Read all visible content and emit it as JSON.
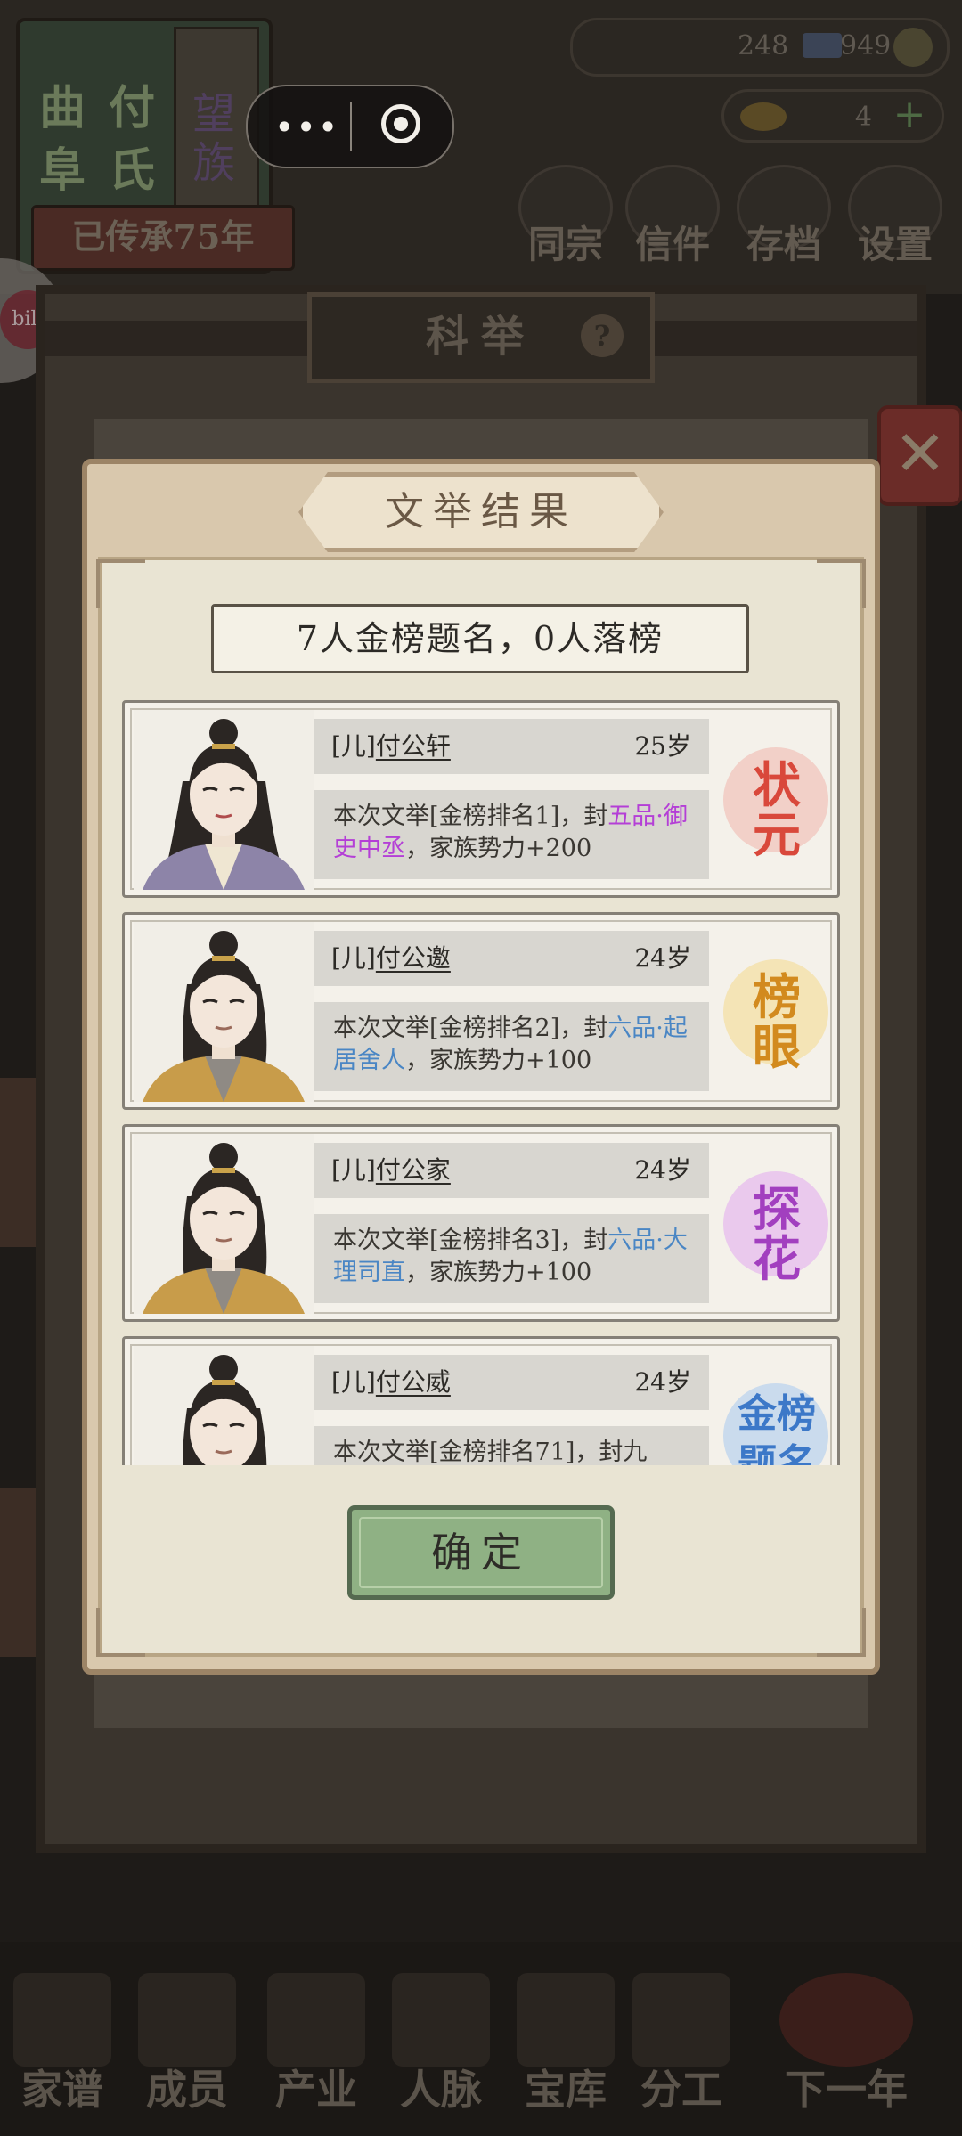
{
  "wechat_capsule": {
    "more_label": "•••"
  },
  "clan": {
    "chars_left": [
      "曲",
      "阜"
    ],
    "chars_right": [
      "付",
      "氏"
    ],
    "strip_chars": [
      "望",
      "族"
    ],
    "inherit_label": "已传承75年"
  },
  "resources": {
    "coins": "248",
    "money": "949",
    "gold": "4"
  },
  "top_nav": [
    {
      "label": "同宗",
      "icon": "book-icon"
    },
    {
      "label": "信件",
      "icon": "letter-icon"
    },
    {
      "label": "存档",
      "icon": "scroll-icon"
    },
    {
      "label": "设置",
      "icon": "gear-icon"
    }
  ],
  "bili_label": "bili",
  "page": {
    "title": "科举",
    "help": "?"
  },
  "modal": {
    "title": "文举结果",
    "summary": "7人金榜题名，0人落榜",
    "confirm_label": "确定"
  },
  "results": [
    {
      "relation": "[儿]",
      "name": "付公轩",
      "age": "25岁",
      "desc_pre": "本次文举[金榜排名1]，封",
      "rank_title": "五品·御史中丞",
      "rank_color": "purple",
      "desc_post": "，家族势力+200",
      "seal": [
        "状",
        "元"
      ],
      "seal_color": "#d9483b",
      "seal_bg": "#f0b4ac",
      "portrait": "female-long-hair"
    },
    {
      "relation": "[儿]",
      "name": "付公邀",
      "age": "24岁",
      "desc_pre": "本次文举[金榜排名2]，封",
      "rank_title": "六品·起居舍人",
      "rank_color": "blue",
      "desc_post": "，家族势力+100",
      "seal": [
        "榜",
        "眼"
      ],
      "seal_color": "#d28a1e",
      "seal_bg": "#f4d98a",
      "portrait": "male-gold-robe"
    },
    {
      "relation": "[儿]",
      "name": "付公家",
      "age": "24岁",
      "desc_pre": "本次文举[金榜排名3]，封",
      "rank_title": "六品·大理司直",
      "rank_color": "blue",
      "desc_post": "，家族势力+100",
      "seal": [
        "探",
        "花"
      ],
      "seal_color": "#a23fbf",
      "seal_bg": "#e1a8ef",
      "portrait": "male-gold-robe"
    },
    {
      "relation": "[儿]",
      "name": "付公威",
      "age": "24岁",
      "desc_pre": "本次文举[金榜排名71]，封九",
      "rank_title": "",
      "rank_color": "blue",
      "desc_post": "",
      "seal": [
        "金榜",
        "题名"
      ],
      "seal_color": "#3c78c8",
      "seal_bg": "#a8c8ef",
      "portrait": "male-gold-robe"
    }
  ],
  "bottom_nav": [
    "家谱",
    "成员",
    "产业",
    "人脉",
    "宝库",
    "分工",
    "下一年"
  ]
}
